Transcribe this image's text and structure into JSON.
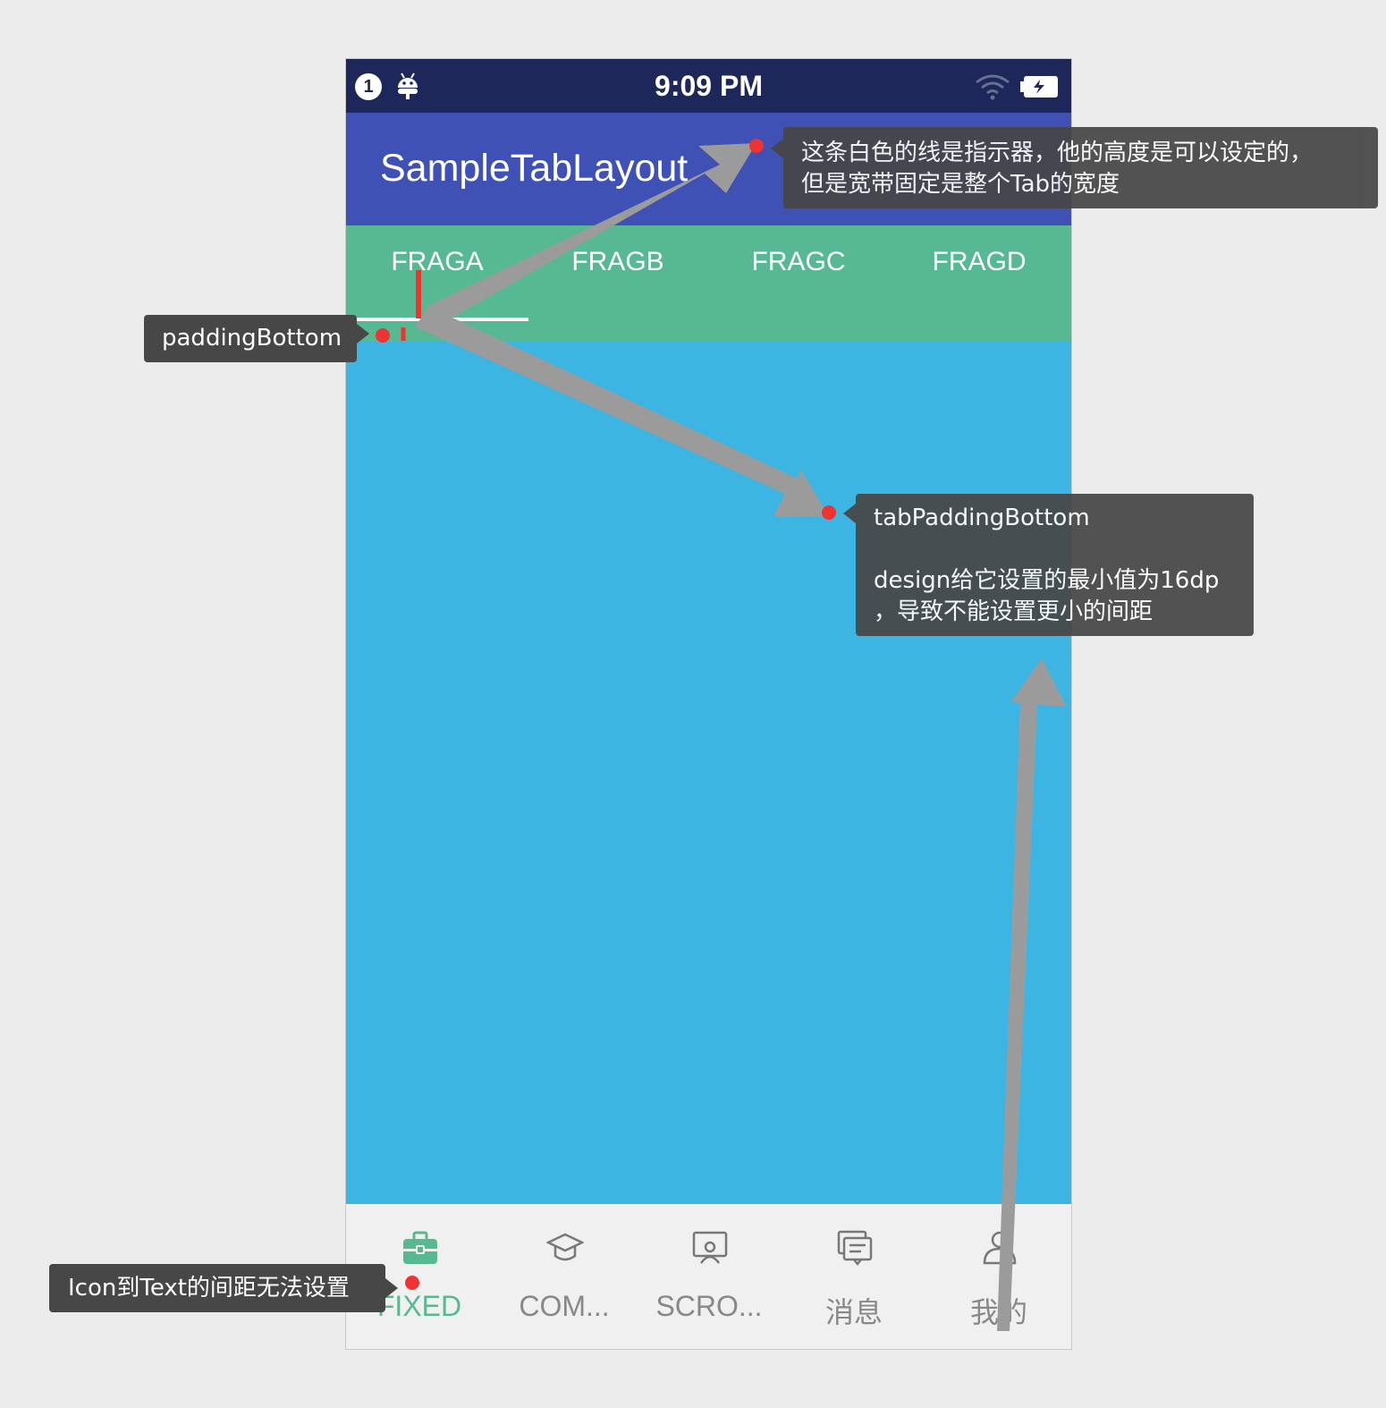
{
  "statusbar": {
    "notification_count": "1",
    "time": "9:09 PM"
  },
  "appbar": {
    "title": "SampleTabLayout"
  },
  "tabs": [
    {
      "label": "FRAGA",
      "selected": true
    },
    {
      "label": "FRAGB",
      "selected": false
    },
    {
      "label": "FRAGC",
      "selected": false
    },
    {
      "label": "FRAGD",
      "selected": false
    }
  ],
  "bottom_nav": [
    {
      "label": "FIXED",
      "icon": "briefcase-icon",
      "active": true
    },
    {
      "label": "COM...",
      "icon": "graduation-cap-icon",
      "active": false
    },
    {
      "label": "SCRO...",
      "icon": "presentation-icon",
      "active": false
    },
    {
      "label": "消息",
      "icon": "message-icon",
      "active": false
    },
    {
      "label": "我的",
      "icon": "person-icon",
      "active": false
    }
  ],
  "annotations": {
    "indicator_note": {
      "line1": "这条白色的线是指示器，他的高度是可以设定的，",
      "line2": "但是宽带固定是整个Tab的宽度"
    },
    "padding_bottom": "paddingBottom",
    "tab_padding_bottom": {
      "title": "tabPaddingBottom",
      "line1": "design给它设置的最小值为16dp",
      "line2": "，导致不能设置更小的间距"
    },
    "icon_text_spacing": "Icon到Text的间距无法设置"
  },
  "colors": {
    "statusbar": "#1e275a",
    "appbar": "#3f51b5",
    "tabbar": "#57b991",
    "content": "#3db5e3",
    "annotation_bg": "#474747",
    "marker_red": "#ee3333",
    "arrow_gray": "#9b9b9b"
  }
}
